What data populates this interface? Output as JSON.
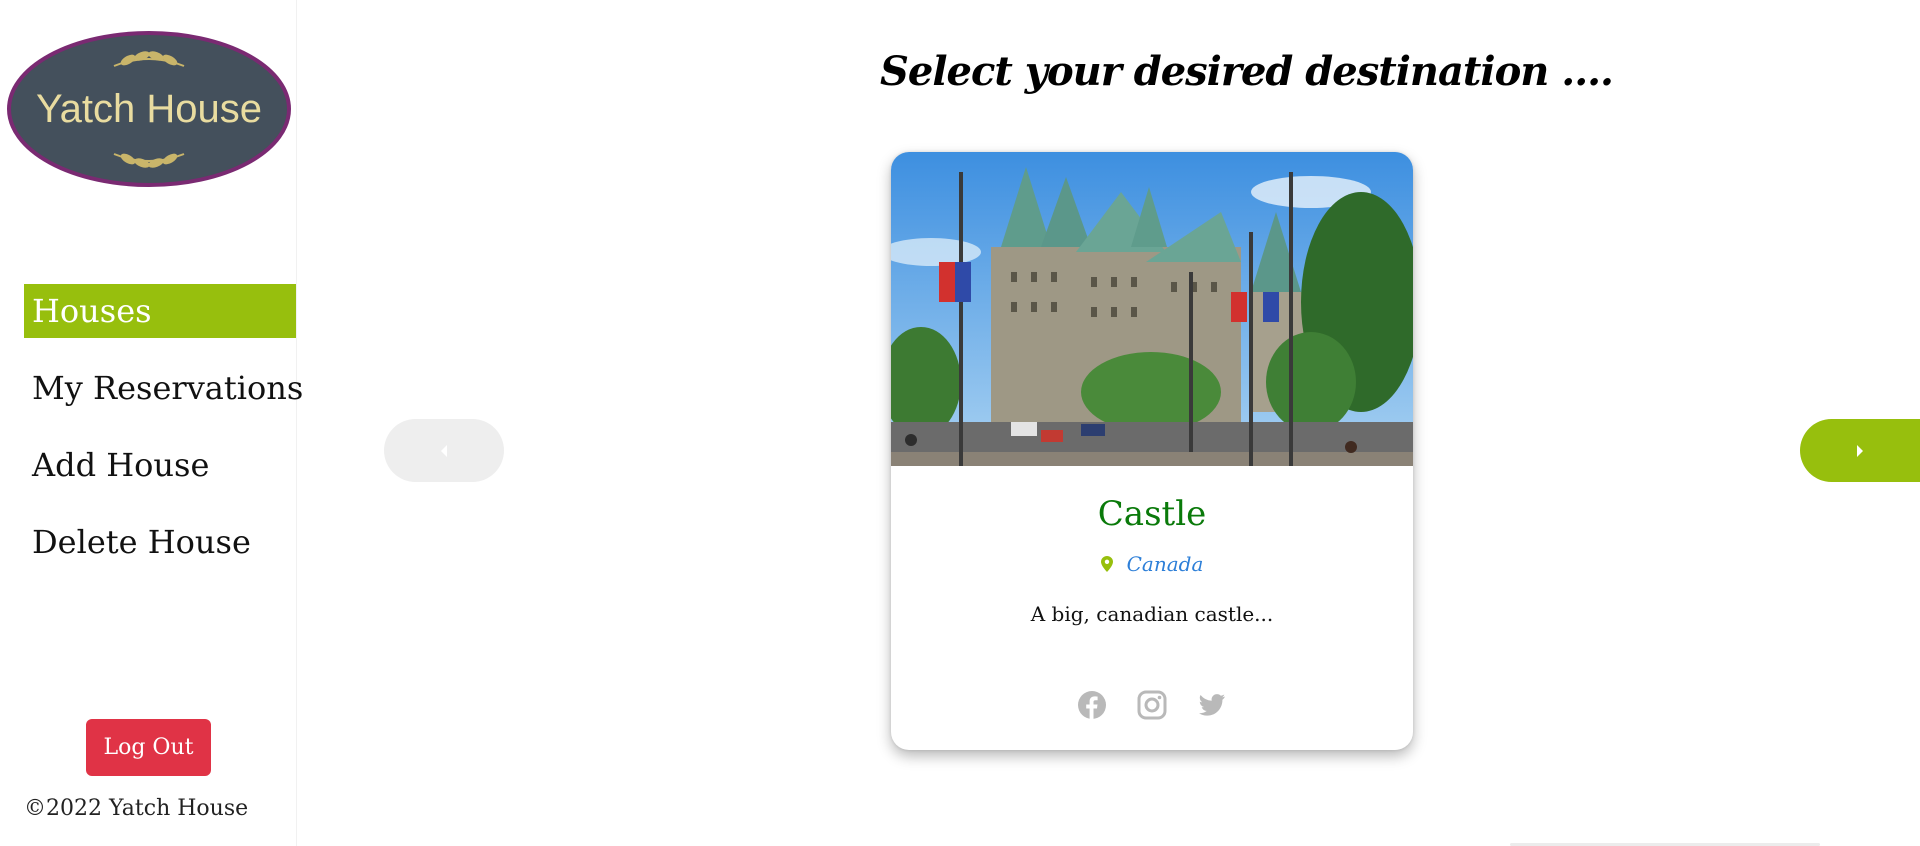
{
  "sidebar": {
    "logo_text": "Yatch House",
    "nav": [
      {
        "label": "Houses",
        "active": true
      },
      {
        "label": "My Reservations",
        "active": false
      },
      {
        "label": "Add House",
        "active": false
      },
      {
        "label": "Delete House",
        "active": false
      }
    ],
    "logout_label": "Log Out",
    "copyright": "©2022 Yatch House"
  },
  "main": {
    "heading": "Select your desired destination ....",
    "card": {
      "title": "Castle",
      "location": "Canada",
      "description": "A big, canadian castle..."
    }
  },
  "colors": {
    "accent": "#97bf0d",
    "danger": "#e03346",
    "title_green": "#0a7a0a",
    "location_blue": "#2d7fd8",
    "logo_bg": "#44505c",
    "logo_border": "#7a2a72",
    "logo_text": "#e9dca0"
  },
  "icons": [
    "leaf-branch-icon",
    "chevron-left-icon",
    "chevron-right-icon",
    "map-pin-icon",
    "facebook-icon",
    "instagram-icon",
    "twitter-icon"
  ]
}
